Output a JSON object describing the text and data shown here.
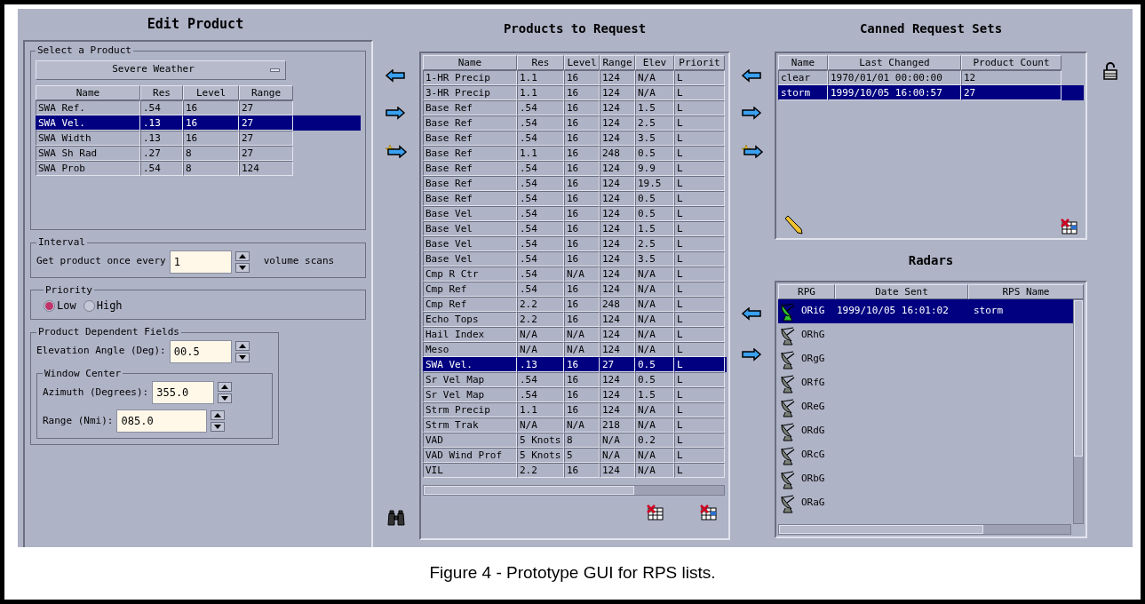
{
  "edit_product": {
    "title": "Edit Product",
    "select_group": {
      "legend": "Select a Product",
      "dropdown": "Severe Weather",
      "columns": [
        "Name",
        "Res",
        "Level",
        "Range"
      ],
      "rows": [
        {
          "cells": [
            "SWA Ref.",
            ".54",
            "16",
            "27"
          ],
          "selected": false
        },
        {
          "cells": [
            "SWA Vel.",
            ".13",
            "16",
            "27"
          ],
          "selected": true
        },
        {
          "cells": [
            "SWA Width",
            ".13",
            "16",
            "27"
          ],
          "selected": false
        },
        {
          "cells": [
            "SWA Sh Rad",
            ".27",
            "8",
            "27"
          ],
          "selected": false
        },
        {
          "cells": [
            "SWA Prob",
            ".54",
            "8",
            "124"
          ],
          "selected": false
        }
      ]
    },
    "interval": {
      "legend": "Interval",
      "label": "Get product once every",
      "value": "1",
      "unit": "volume scans"
    },
    "priority": {
      "legend": "Priority",
      "options": [
        {
          "label": "Low",
          "selected": true
        },
        {
          "label": "High",
          "selected": false
        }
      ]
    },
    "dependent": {
      "legend": "Product Dependent Fields",
      "elevation": {
        "label": "Elevation Angle (Deg):",
        "value": "00.5"
      },
      "window_center": {
        "legend": "Window Center",
        "azimuth": {
          "label": "Azimuth (Degrees):",
          "value": "355.0"
        },
        "range": {
          "label": "Range (Nmi):",
          "value": "085.0"
        }
      }
    }
  },
  "products_to_request": {
    "title": "Products to Request",
    "columns": [
      "Name",
      "Res",
      "Level",
      "Range",
      "Elev",
      "Priorit"
    ],
    "rows": [
      {
        "cells": [
          "1-HR Precip",
          "1.1",
          "16",
          "124",
          "N/A",
          "L"
        ],
        "selected": false
      },
      {
        "cells": [
          "3-HR Precip",
          "1.1",
          "16",
          "124",
          "N/A",
          "L"
        ],
        "selected": false
      },
      {
        "cells": [
          "Base Ref",
          ".54",
          "16",
          "124",
          "1.5",
          "L"
        ],
        "selected": false
      },
      {
        "cells": [
          "Base Ref",
          ".54",
          "16",
          "124",
          "2.5",
          "L"
        ],
        "selected": false
      },
      {
        "cells": [
          "Base Ref",
          ".54",
          "16",
          "124",
          "3.5",
          "L"
        ],
        "selected": false
      },
      {
        "cells": [
          "Base Ref",
          "1.1",
          "16",
          "248",
          "0.5",
          "L"
        ],
        "selected": false
      },
      {
        "cells": [
          "Base Ref",
          ".54",
          "16",
          "124",
          "9.9",
          "L"
        ],
        "selected": false
      },
      {
        "cells": [
          "Base Ref",
          ".54",
          "16",
          "124",
          "19.5",
          "L"
        ],
        "selected": false
      },
      {
        "cells": [
          "Base Ref",
          ".54",
          "16",
          "124",
          "0.5",
          "L"
        ],
        "selected": false
      },
      {
        "cells": [
          "Base Vel",
          ".54",
          "16",
          "124",
          "0.5",
          "L"
        ],
        "selected": false
      },
      {
        "cells": [
          "Base Vel",
          ".54",
          "16",
          "124",
          "1.5",
          "L"
        ],
        "selected": false
      },
      {
        "cells": [
          "Base Vel",
          ".54",
          "16",
          "124",
          "2.5",
          "L"
        ],
        "selected": false
      },
      {
        "cells": [
          "Base Vel",
          ".54",
          "16",
          "124",
          "3.5",
          "L"
        ],
        "selected": false
      },
      {
        "cells": [
          "Cmp R Ctr",
          ".54",
          "N/A",
          "124",
          "N/A",
          "L"
        ],
        "selected": false
      },
      {
        "cells": [
          "Cmp Ref",
          ".54",
          "16",
          "124",
          "N/A",
          "L"
        ],
        "selected": false
      },
      {
        "cells": [
          "Cmp Ref",
          "2.2",
          "16",
          "248",
          "N/A",
          "L"
        ],
        "selected": false
      },
      {
        "cells": [
          "Echo Tops",
          "2.2",
          "16",
          "124",
          "N/A",
          "L"
        ],
        "selected": false
      },
      {
        "cells": [
          "Hail Index",
          "N/A",
          "N/A",
          "124",
          "N/A",
          "L"
        ],
        "selected": false
      },
      {
        "cells": [
          "Meso",
          "N/A",
          "N/A",
          "124",
          "N/A",
          "L"
        ],
        "selected": false
      },
      {
        "cells": [
          "SWA Vel.",
          ".13",
          "16",
          "27",
          "0.5",
          "L"
        ],
        "selected": true
      },
      {
        "cells": [
          "Sr Vel Map",
          ".54",
          "16",
          "124",
          "0.5",
          "L"
        ],
        "selected": false
      },
      {
        "cells": [
          "Sr Vel Map",
          ".54",
          "16",
          "124",
          "1.5",
          "L"
        ],
        "selected": false
      },
      {
        "cells": [
          "Strm Precip",
          "1.1",
          "16",
          "124",
          "N/A",
          "L"
        ],
        "selected": false
      },
      {
        "cells": [
          "Strm Trak",
          "N/A",
          "N/A",
          "218",
          "N/A",
          "L"
        ],
        "selected": false
      },
      {
        "cells": [
          "VAD",
          "5 Knots",
          "8",
          "N/A",
          "0.2",
          "L"
        ],
        "selected": false
      },
      {
        "cells": [
          "VAD Wind Prof",
          "5 Knots",
          "5",
          "N/A",
          "N/A",
          "L"
        ],
        "selected": false
      },
      {
        "cells": [
          "VIL",
          "2.2",
          "16",
          "124",
          "N/A",
          "L"
        ],
        "selected": false
      }
    ]
  },
  "canned_request_sets": {
    "title": "Canned Request Sets",
    "columns": [
      "Name",
      "Last Changed",
      "Product Count"
    ],
    "rows": [
      {
        "cells": [
          "clear",
          "1970/01/01 00:00:00",
          "12"
        ],
        "selected": false
      },
      {
        "cells": [
          "storm",
          "1999/10/05 16:00:57",
          "27"
        ],
        "selected": true
      }
    ]
  },
  "radars": {
    "title": "Radars",
    "columns": [
      "RPG",
      "Date Sent",
      "RPS Name"
    ],
    "rows": [
      {
        "rpg": "ORiG",
        "date_sent": "1999/10/05 16:01:02",
        "rps_name": "storm",
        "selected": true
      },
      {
        "rpg": "ORhG",
        "selected": false
      },
      {
        "rpg": "ORgG",
        "selected": false
      },
      {
        "rpg": "ORfG",
        "selected": false
      },
      {
        "rpg": "OReG",
        "selected": false
      },
      {
        "rpg": "ORdG",
        "selected": false
      },
      {
        "rpg": "ORcG",
        "selected": false
      },
      {
        "rpg": "ORbG",
        "selected": false
      },
      {
        "rpg": "ORaG",
        "selected": false
      }
    ]
  },
  "caption": "Figure 4 - Prototype GUI for RPS lists."
}
